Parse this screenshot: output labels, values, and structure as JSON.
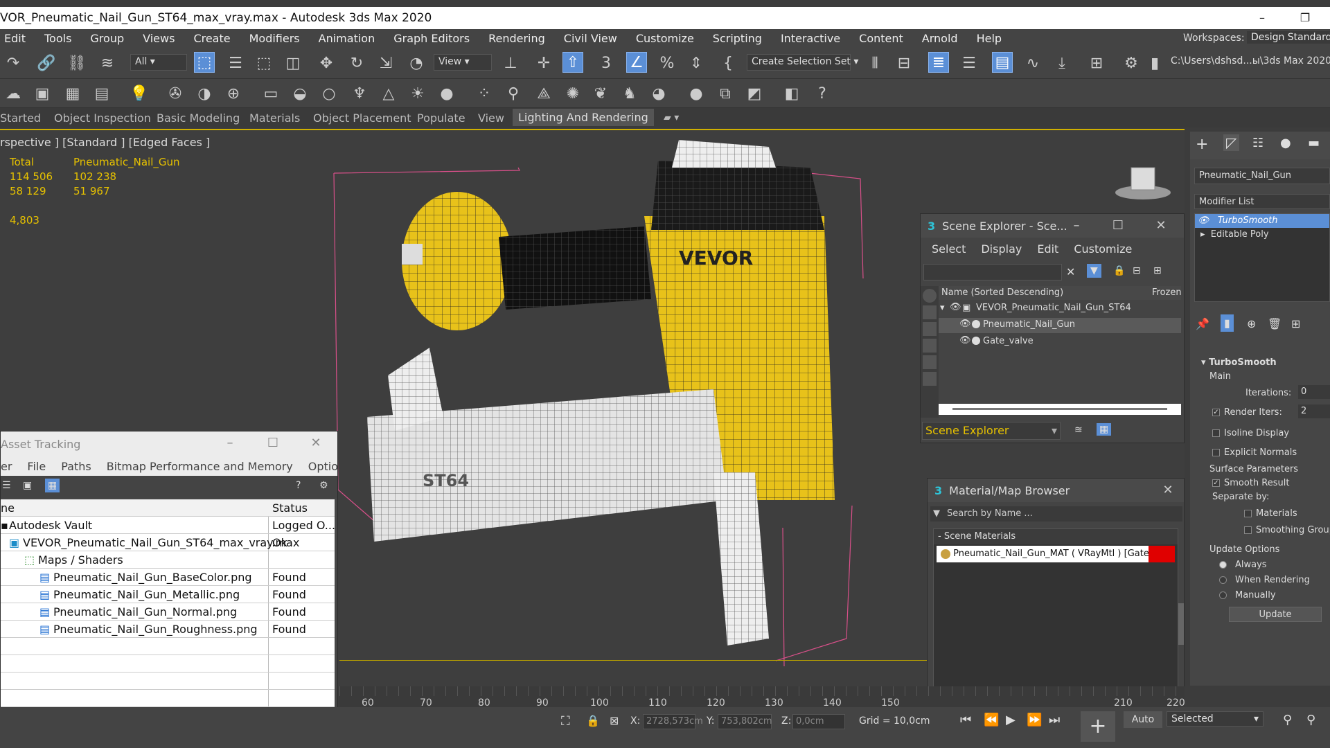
{
  "title": "VOR_Pneumatic_Nail_Gun_ST64_max_vray.max - Autodesk 3ds Max 2020",
  "window_controls": [
    "–",
    "❐"
  ],
  "menu": [
    "Edit",
    "Tools",
    "Group",
    "Views",
    "Create",
    "Modifiers",
    "Animation",
    "Graph Editors",
    "Rendering",
    "Civil View",
    "Customize",
    "Scripting",
    "Interactive",
    "Content",
    "Arnold",
    "Help"
  ],
  "workspace": {
    "label": "Workspaces:",
    "value": "Design Standard"
  },
  "toolbar": {
    "filter": "All",
    "refcoord": "View",
    "selset": "Create Selection Set",
    "path": "C:\\Users\\dshsd...ы\\3ds Max 2020"
  },
  "ribbon": [
    "Started",
    "Object Inspection",
    "Basic Modeling",
    "Materials",
    "Object Placement",
    "Populate",
    "View",
    "Lighting And Rendering"
  ],
  "viewport": {
    "label": "rspective ] [Standard ] [Edged Faces ]",
    "stats": [
      [
        "Total",
        "Pneumatic_Nail_Gun"
      ],
      [
        "114 506",
        "102 238"
      ],
      [
        "58 129",
        "51 967"
      ],
      [
        "",
        ""
      ],
      [
        "4,803",
        ""
      ]
    ],
    "brand": "VEVOR",
    "model_text": "ST64"
  },
  "asset_tracking": {
    "title": "Asset Tracking",
    "menu": [
      "er",
      "File",
      "Paths",
      "Bitmap Performance and Memory",
      "Options"
    ],
    "col_name": "ne",
    "col_status": "Status",
    "rows": [
      {
        "name": "Autodesk Vault",
        "status": "Logged O..."
      },
      {
        "name": "VEVOR_Pneumatic_Nail_Gun_ST64_max_vray.max",
        "status": "Ok"
      },
      {
        "name": "Maps / Shaders",
        "status": ""
      },
      {
        "name": "Pneumatic_Nail_Gun_BaseColor.png",
        "status": "Found"
      },
      {
        "name": "Pneumatic_Nail_Gun_Metallic.png",
        "status": "Found"
      },
      {
        "name": "Pneumatic_Nail_Gun_Normal.png",
        "status": "Found"
      },
      {
        "name": "Pneumatic_Nail_Gun_Roughness.png",
        "status": "Found"
      }
    ]
  },
  "scene_explorer": {
    "title": "Scene Explorer - Sce...",
    "menu": [
      "Select",
      "Display",
      "Edit",
      "Customize"
    ],
    "col_name": "Name (Sorted Descending)",
    "col_frozen": "Frozen",
    "items": [
      "VEVOR_Pneumatic_Nail_Gun_ST64",
      "Pneumatic_Nail_Gun",
      "Gate_valve"
    ],
    "footer": "Scene Explorer"
  },
  "material_browser": {
    "title": "Material/Map Browser",
    "search_placeholder": "Search by Name ...",
    "section": "Scene Materials",
    "item": "Pneumatic_Nail_Gun_MAT  ( VRayMtl )  [Gate..."
  },
  "command_panel": {
    "object_name": "Pneumatic_Nail_Gun",
    "modifier_list": "Modifier List",
    "stack": [
      "TurboSmooth",
      "Editable Poly"
    ],
    "rollout": "TurboSmooth",
    "main": "Main",
    "iterations_label": "Iterations:",
    "iterations": "0",
    "render_iters_label": "Render Iters:",
    "render_iters": "2",
    "isoline": "Isoline Display",
    "explicit": "Explicit Normals",
    "surface": "Surface Parameters",
    "smooth": "Smooth Result",
    "separate": "Separate by:",
    "materials": "Materials",
    "smoothing_groups": "Smoothing Groups",
    "update_options": "Update Options",
    "always": "Always",
    "when_rendering": "When Rendering",
    "manually": "Manually",
    "update_btn": "Update"
  },
  "timeline_ticks": [
    "60",
    "70",
    "80",
    "90",
    "100",
    "110",
    "120",
    "130",
    "140",
    "150",
    "210",
    "220"
  ],
  "status": {
    "x_label": "X:",
    "x": "2728,573cm",
    "y_label": "Y:",
    "y": "753,802cm",
    "z_label": "Z:",
    "z": "0,0cm",
    "grid": "Grid = 10,0cm",
    "auto": "Auto",
    "selected": "Selected"
  }
}
